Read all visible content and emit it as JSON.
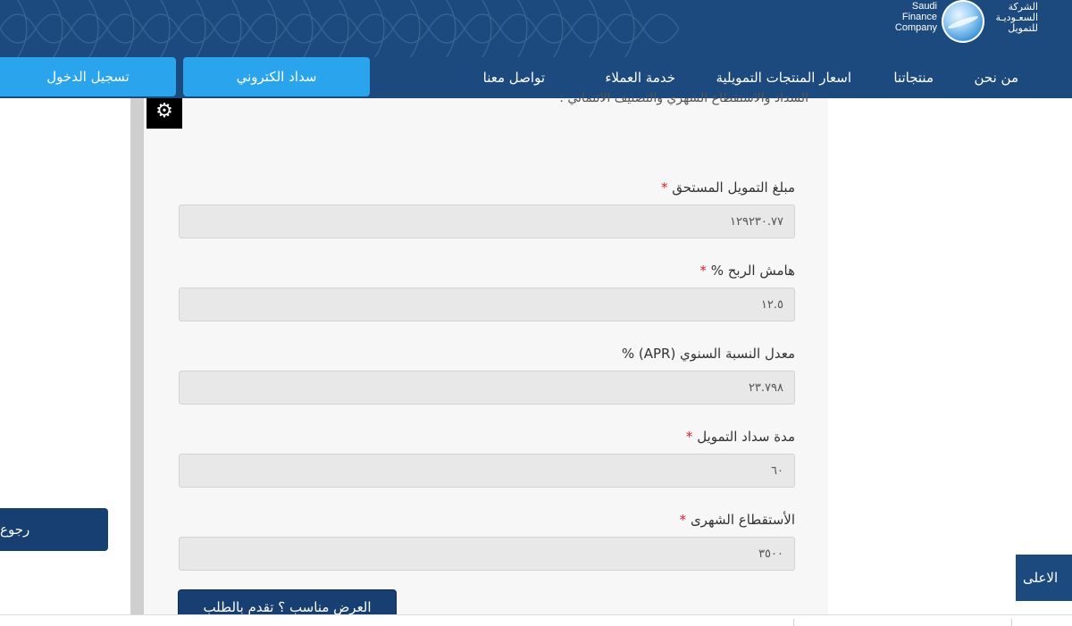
{
  "header": {
    "logo": {
      "en": "Saudi\nFinance\nCompany",
      "ar": "الشركة\nالسعـوديـة\nللتمويل"
    },
    "nav": [
      {
        "label": "من نحن"
      },
      {
        "label": "منتجاتنا"
      },
      {
        "label": "اسعار المنتجات التمويلية"
      },
      {
        "label": "خدمة العملاء"
      },
      {
        "label": "تواصل معنا"
      }
    ],
    "electronic_payment_label": "سداد الكتروني",
    "login_label": "تسجيل الدخول"
  },
  "panel": {
    "intro_text": "السداد والاستقطاع الشهري والتصنيف الائتماني :",
    "fields": [
      {
        "label": "مبلغ التمويل المستحق",
        "required": "*",
        "value": "١٢٩٢٣٠.٧٧"
      },
      {
        "label": "هامش الربح %",
        "required": "*",
        "value": "١٢.٥"
      },
      {
        "label": "معدل النسبة السنوي (APR) %",
        "required": "",
        "value": "٢٣.٧٩٨"
      },
      {
        "label": "مدة سداد التمويل",
        "required": "*",
        "value": "٦٠"
      },
      {
        "label": "الأستقطاع الشهرى",
        "required": "*",
        "value": "٣٥٠٠"
      }
    ],
    "submit_label": "العرض مناسب ؟ تقدم بالطلب"
  },
  "back_label": "رجوع",
  "top_label": "الاعلى",
  "colors": {
    "brand": "#1d4a7e",
    "accent": "#2aa4ec",
    "dark_button": "#173f72",
    "required": "#e02424"
  },
  "icons": {
    "settings": "gear-icon"
  }
}
